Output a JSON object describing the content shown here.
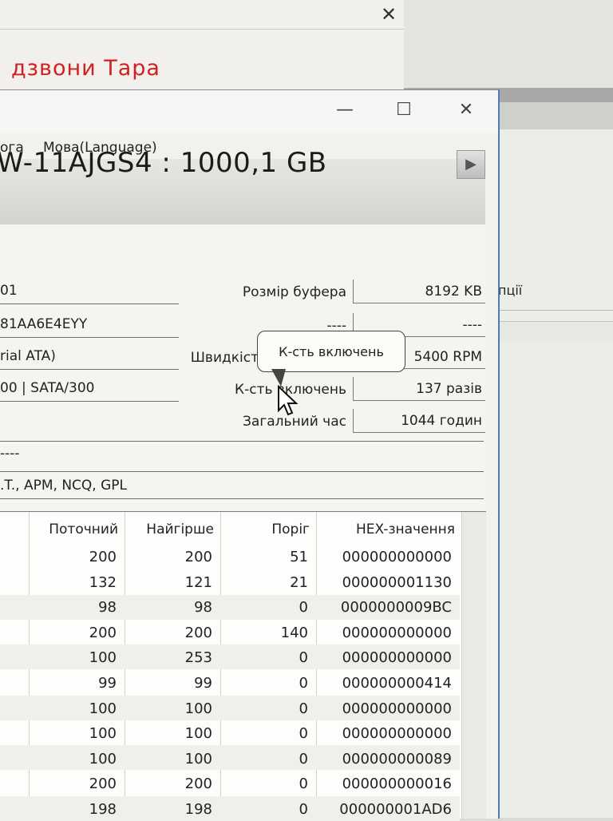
{
  "background_window": {
    "title": "дзвони  Тара",
    "close_label": "✕"
  },
  "right_window": {
    "cut_text": "пції"
  },
  "window": {
    "minimize_label": "—",
    "maximize_label": "☐",
    "close_label": "✕"
  },
  "menu": {
    "items": [
      "ога",
      "Мова(Language)"
    ]
  },
  "disk": {
    "model_line": "W-11AJGS4 : 1000,1 GB",
    "play_label": "▶"
  },
  "left_fields": [
    "01",
    "81AA6E4EYY",
    "rial ATA)",
    "00 | SATA/300"
  ],
  "right_fields": [
    {
      "label": "Розмір буфера",
      "value": "8192 KB"
    },
    {
      "label": "----",
      "value": "----"
    },
    {
      "label": "Швидкіст",
      "value": "5400 RPM"
    },
    {
      "label": "К-сть включень",
      "value": "137 разів"
    },
    {
      "label": "Загальний час",
      "value": "1044 годин"
    }
  ],
  "dashes_row": "----",
  "features_row": ".T., APM, NCQ, GPL",
  "tooltip": {
    "text": "К-сть включень"
  },
  "smart_table": {
    "headers": [
      "Поточний",
      "Найгірше",
      "Поріг",
      "HEX-значення"
    ],
    "rows": [
      [
        "200",
        "200",
        "51",
        "000000000000"
      ],
      [
        "132",
        "121",
        "21",
        "000000001130"
      ],
      [
        "98",
        "98",
        "0",
        "0000000009BC"
      ],
      [
        "200",
        "200",
        "140",
        "000000000000"
      ],
      [
        "100",
        "253",
        "0",
        "000000000000"
      ],
      [
        "99",
        "99",
        "0",
        "000000000414"
      ],
      [
        "100",
        "100",
        "0",
        "000000000000"
      ],
      [
        "100",
        "100",
        "0",
        "000000000000"
      ],
      [
        "100",
        "100",
        "0",
        "000000000089"
      ],
      [
        "200",
        "200",
        "0",
        "000000000016"
      ],
      [
        "198",
        "198",
        "0",
        "000000001AD6"
      ]
    ]
  },
  "colors": {
    "accent_red": "#d21f1f",
    "window_border": "#4f7bb0"
  }
}
